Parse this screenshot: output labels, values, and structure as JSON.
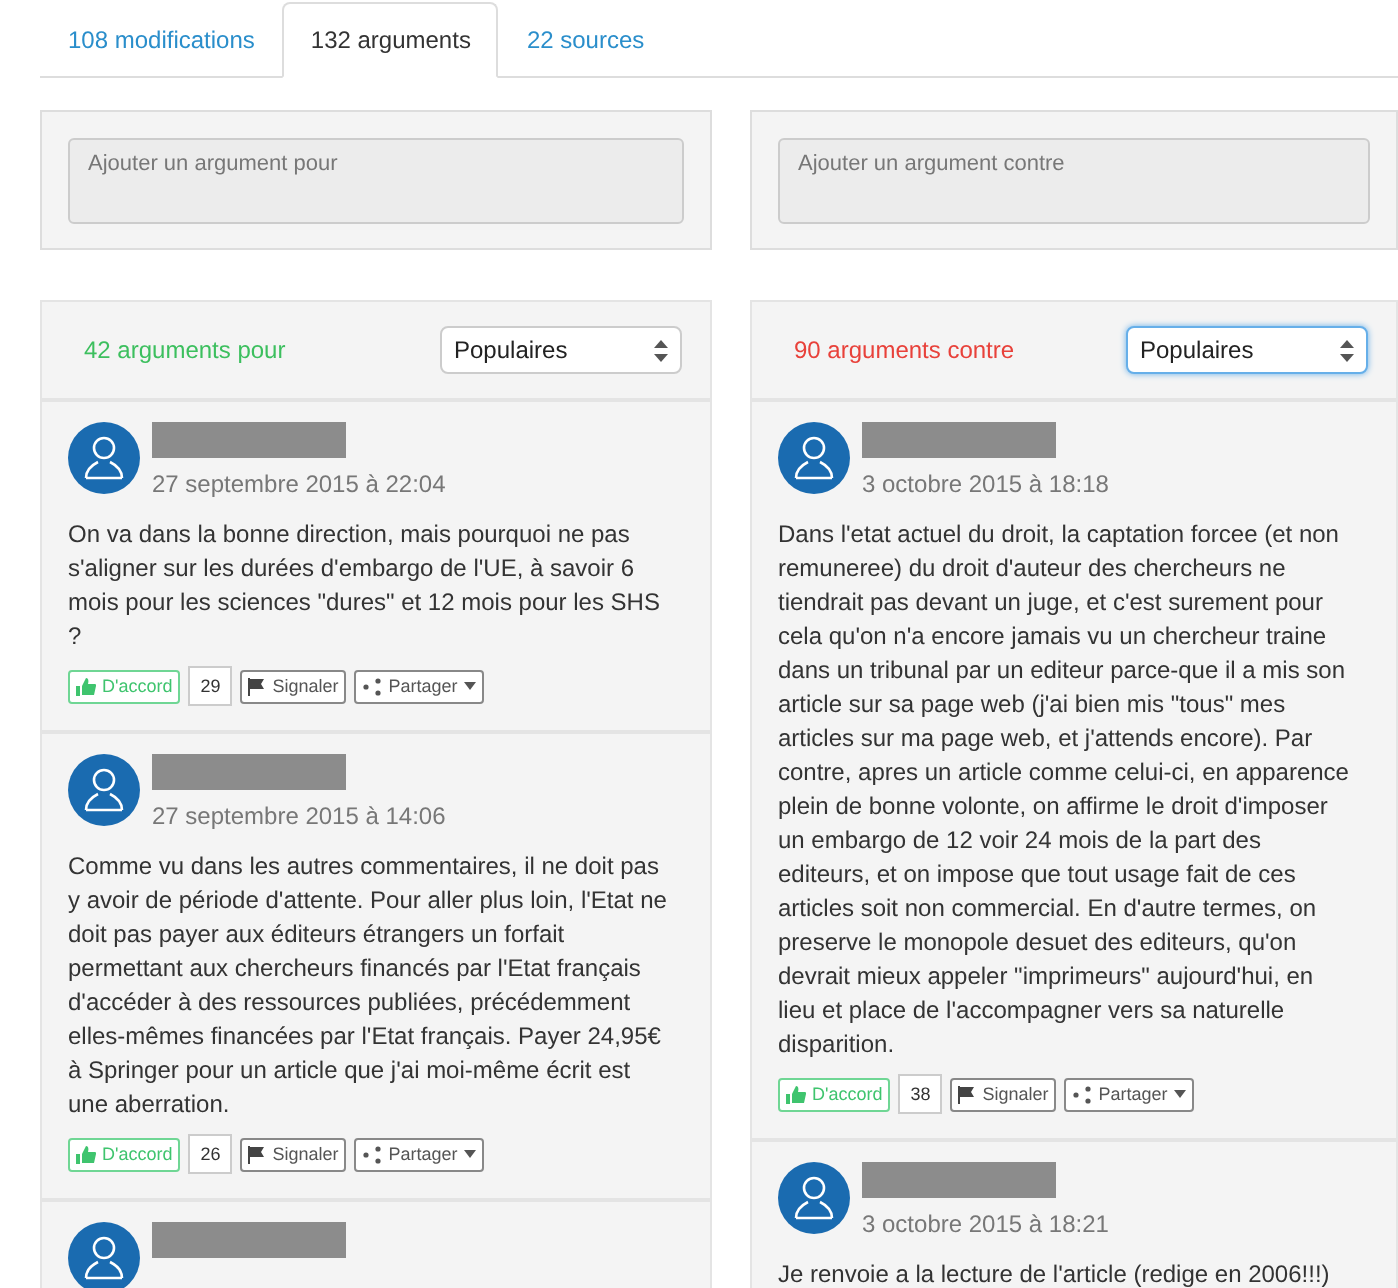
{
  "tabs": [
    {
      "label": "108 modifications",
      "selected": false
    },
    {
      "label": "132 arguments",
      "selected": true
    },
    {
      "label": "22 sources",
      "selected": false
    }
  ],
  "columns": [
    {
      "kind": "pro",
      "input": {
        "placeholder": "Ajouter un argument pour"
      },
      "count_label": "42 arguments pour",
      "sort": "Populaires",
      "focused": false,
      "comments": [
        {
          "date": "27 septembre 2015 à 22:04",
          "text": "On va dans la bonne direction, mais pourquoi ne pas s'aligner sur les durées d'embargo de l'UE, à savoir 6 mois pour les sciences \"dures\" et 12 mois pour les SHS ?",
          "agree": "D'accord",
          "votes": "29",
          "report": "Signaler",
          "share": "Partager"
        },
        {
          "date": "27 septembre 2015 à 14:06",
          "text": "Comme vu dans les autres commentaires, il ne doit pas y avoir de période d'attente. Pour aller plus loin, l'Etat ne doit pas payer aux éditeurs étrangers un forfait permettant aux chercheurs financés par l'Etat français d'accéder à des ressources publiées, précédemment elles-mêmes financées par l'Etat français. Payer 24,95€ à Springer pour un article que j'ai moi-même écrit est une aberration.",
          "agree": "D'accord",
          "votes": "26",
          "report": "Signaler",
          "share": "Partager"
        },
        {
          "author_hidden": true
        }
      ]
    },
    {
      "kind": "con",
      "input": {
        "placeholder": "Ajouter un argument contre"
      },
      "count_label": "90 arguments contre",
      "sort": "Populaires",
      "focused": true,
      "comments": [
        {
          "date": "3 octobre 2015 à 18:18",
          "text": "Dans l'etat actuel du droit, la captation forcee (et non remuneree) du droit d'auteur des chercheurs ne tiendrait pas devant un juge, et c'est surement pour cela qu'on n'a encore jamais vu un chercheur traine dans un tribunal par un editeur parce-que il a mis son article sur sa page web (j'ai bien mis \"tous\" mes articles sur ma page web, et j'attends encore). Par contre, apres un article comme celui-ci, en apparence plein de bonne volonte, on affirme le droit d'imposer un embargo de 12 voir 24 mois de la part des editeurs, et on impose que tout usage fait de ces articles soit non commercial. En d'autre termes, on preserve le monopole desuet des editeurs, qu'on devrait mieux appeler \"imprimeurs\" aujourd'hui, en lieu et place de l'accompagner vers sa naturelle disparition.",
          "agree": "D'accord",
          "votes": "38",
          "report": "Signaler",
          "share": "Partager"
        },
        {
          "date": "3 octobre 2015 à 18:21",
          "text": "Je renvoie a la lecture de l'article (redige en 2006!!!)"
        }
      ]
    }
  ]
}
